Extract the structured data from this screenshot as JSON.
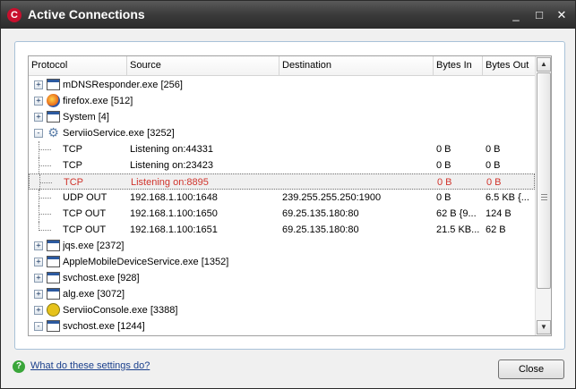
{
  "window": {
    "title": "Active Connections",
    "icon_letter": "C",
    "controls": {
      "close": "✕",
      "maximize": "□",
      "minimize": "_"
    }
  },
  "columns": [
    "Protocol",
    "Source",
    "Destination",
    "Bytes In",
    "Bytes Out"
  ],
  "rows": [
    {
      "type": "process",
      "expander": "+",
      "icon": "window-icon",
      "name": "mDNSResponder.exe [256]"
    },
    {
      "type": "process",
      "expander": "+",
      "icon": "firefox-icon",
      "name": "firefox.exe [512]"
    },
    {
      "type": "process",
      "expander": "+",
      "icon": "window-icon",
      "name": "System [4]"
    },
    {
      "type": "process",
      "expander": "-",
      "icon": "gear-icon",
      "name": "ServiioService.exe [3252]"
    },
    {
      "type": "connection",
      "protocol": "TCP",
      "source": "Listening on:44331",
      "destination": "",
      "bytes_in": "0 B",
      "bytes_out": "0 B"
    },
    {
      "type": "connection",
      "protocol": "TCP",
      "source": "Listening on:23423",
      "destination": "",
      "bytes_in": "0 B",
      "bytes_out": "0 B"
    },
    {
      "type": "connection",
      "protocol": "TCP",
      "source": "Listening on:8895",
      "destination": "",
      "bytes_in": "0 B",
      "bytes_out": "0 B",
      "selected": true,
      "alert": true
    },
    {
      "type": "connection",
      "protocol": "UDP OUT",
      "source": "192.168.1.100:1648",
      "destination": "239.255.255.250:1900",
      "bytes_in": "0 B",
      "bytes_out": "6.5 KB {..."
    },
    {
      "type": "connection",
      "protocol": "TCP OUT",
      "source": "192.168.1.100:1650",
      "destination": "69.25.135.180:80",
      "bytes_in": "62 B {9...",
      "bytes_out": "124 B"
    },
    {
      "type": "connection",
      "protocol": "TCP OUT",
      "source": "192.168.1.100:1651",
      "destination": "69.25.135.180:80",
      "bytes_in": "21.5 KB...",
      "bytes_out": "62 B"
    },
    {
      "type": "process",
      "expander": "+",
      "icon": "window-icon",
      "name": "jqs.exe [2372]"
    },
    {
      "type": "process",
      "expander": "+",
      "icon": "window-icon",
      "name": "AppleMobileDeviceService.exe [1352]"
    },
    {
      "type": "process",
      "expander": "+",
      "icon": "window-icon",
      "name": "svchost.exe [928]"
    },
    {
      "type": "process",
      "expander": "+",
      "icon": "window-icon",
      "name": "alg.exe [3072]"
    },
    {
      "type": "process",
      "expander": "+",
      "icon": "console-icon",
      "name": "ServiioConsole.exe [3388]"
    },
    {
      "type": "process",
      "expander": "-",
      "icon": "window-icon",
      "name": "svchost.exe [1244]"
    }
  ],
  "scrollbar": {
    "up": "▲",
    "down": "▼"
  },
  "help": {
    "icon": "?",
    "link": "What do these settings do?"
  },
  "close_button": "Close",
  "colors": {
    "alert_text": "#d0342c",
    "title_bar": "#3a3a3a",
    "panel_border": "#a9c2d8"
  }
}
